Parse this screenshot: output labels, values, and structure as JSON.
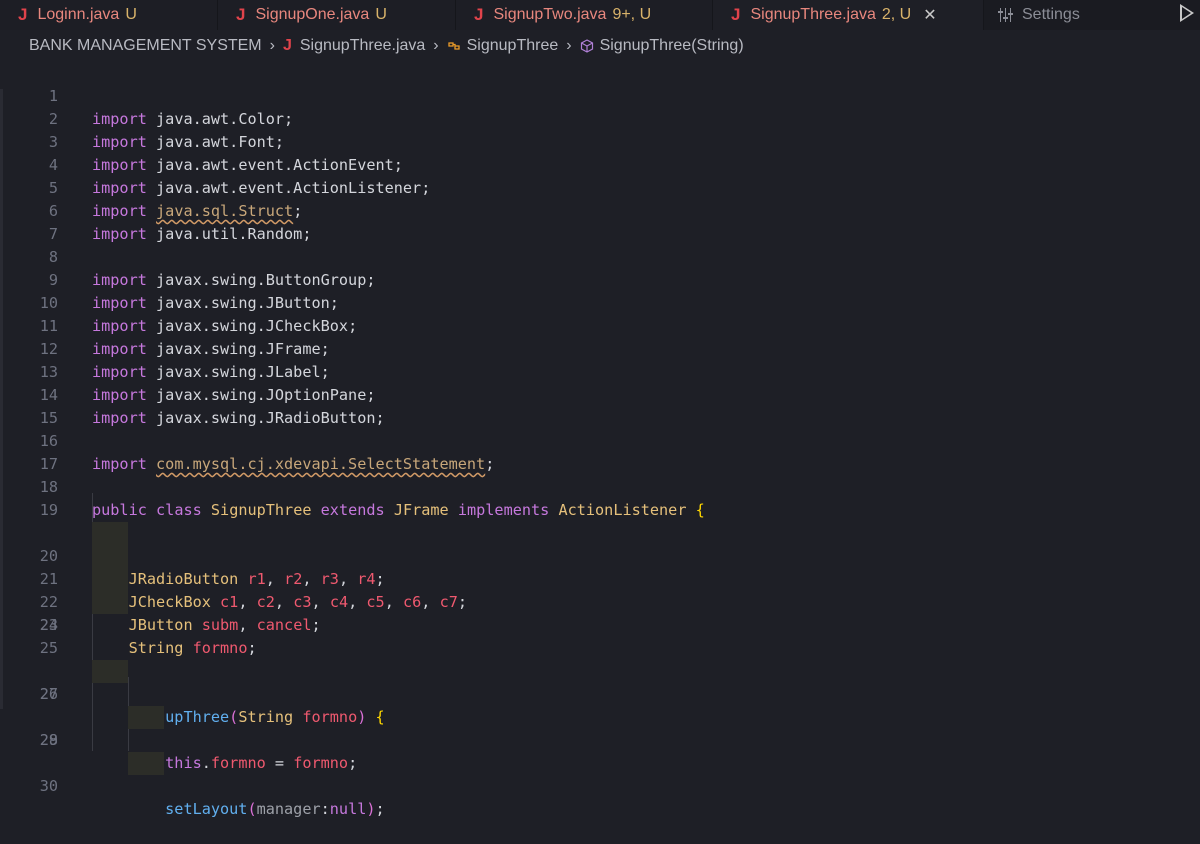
{
  "tabs": [
    {
      "label": "Loginn.java",
      "status": "U",
      "active": false
    },
    {
      "label": "SignupOne.java",
      "status": "U",
      "active": false
    },
    {
      "label": "SignupTwo.java",
      "status": "9+, U",
      "active": false
    },
    {
      "label": "SignupThree.java",
      "status": "2, U",
      "active": true
    },
    {
      "label": "Settings",
      "status": "",
      "active": false
    }
  ],
  "tab_icon": "J",
  "close_glyph": "✕",
  "breadcrumb": {
    "project": "BANK MANAGEMENT SYSTEM",
    "file": "SignupThree.java",
    "class": "SignupThree",
    "method": "SignupThree(String)"
  },
  "lines": [
    {
      "n": "1",
      "text": "import java.awt.Color;"
    },
    {
      "n": "2",
      "text": "import java.awt.Font;"
    },
    {
      "n": "3",
      "text": "import java.awt.event.ActionEvent;"
    },
    {
      "n": "4",
      "text": "import java.awt.event.ActionListener;"
    },
    {
      "n": "5",
      "text": "import java.sql.Struct;"
    },
    {
      "n": "6",
      "text": "import java.util.Random;"
    },
    {
      "n": "7",
      "text": ""
    },
    {
      "n": "8",
      "text": "import javax.swing.ButtonGroup;"
    },
    {
      "n": "9",
      "text": "import javax.swing.JButton;"
    },
    {
      "n": "10",
      "text": "import javax.swing.JCheckBox;"
    },
    {
      "n": "11",
      "text": "import javax.swing.JFrame;"
    },
    {
      "n": "12",
      "text": "import javax.swing.JLabel;"
    },
    {
      "n": "13",
      "text": "import javax.swing.JOptionPane;"
    },
    {
      "n": "14",
      "text": "import javax.swing.JRadioButton;"
    },
    {
      "n": "15",
      "text": ""
    },
    {
      "n": "16",
      "text": "import com.mysql.cj.xdevapi.SelectStatement;"
    },
    {
      "n": "17",
      "text": ""
    },
    {
      "n": "18",
      "text": "public class SignupThree extends JFrame implements ActionListener {"
    },
    {
      "n": "19",
      "text": ""
    },
    {
      "n": "20",
      "text": "    JRadioButton r1, r2, r3, r4;"
    },
    {
      "n": "21",
      "text": "    JCheckBox c1, c2, c3, c4, c5, c6, c7;"
    },
    {
      "n": "22",
      "text": "    JButton subm, cancel;"
    },
    {
      "n": "23",
      "text": "    String formno;"
    },
    {
      "n": "24",
      "text": ""
    },
    {
      "n": "25",
      "text": ""
    },
    {
      "n": "26",
      "text": "    SignupThree(String formno) {"
    },
    {
      "n": "27",
      "text": ""
    },
    {
      "n": "28",
      "text": "        this.formno = formno;"
    },
    {
      "n": "29",
      "text": ""
    },
    {
      "n": "30",
      "text": "        setLayout(manager:null);"
    }
  ],
  "colors": {
    "keyword": "#c678dd",
    "type": "#e5c07b",
    "variable": "#ef596f",
    "function": "#61afef",
    "warning": "#d19a66",
    "tab_text": "#e8877e",
    "java_icon": "#e0434b"
  }
}
